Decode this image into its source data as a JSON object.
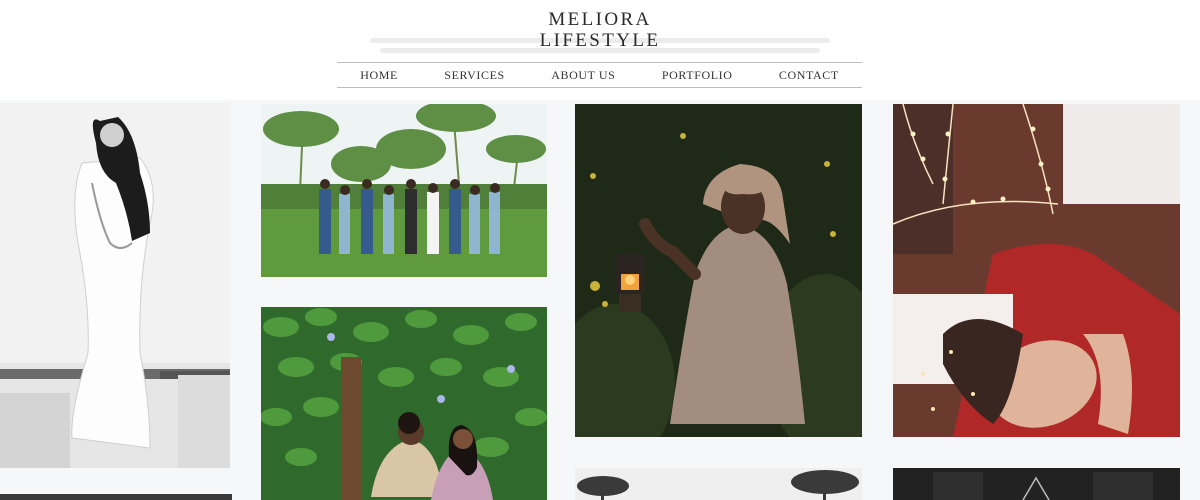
{
  "brand": {
    "line1": "MELIORA",
    "line2": "LIFESTYLE"
  },
  "nav": [
    "HOME",
    "SERVICES",
    "ABOUT US",
    "PORTFOLIO",
    "CONTACT"
  ],
  "colors": {
    "accent": "#2a2a2a",
    "rule": "#bdbdbd",
    "background": "#f6f7f9"
  }
}
